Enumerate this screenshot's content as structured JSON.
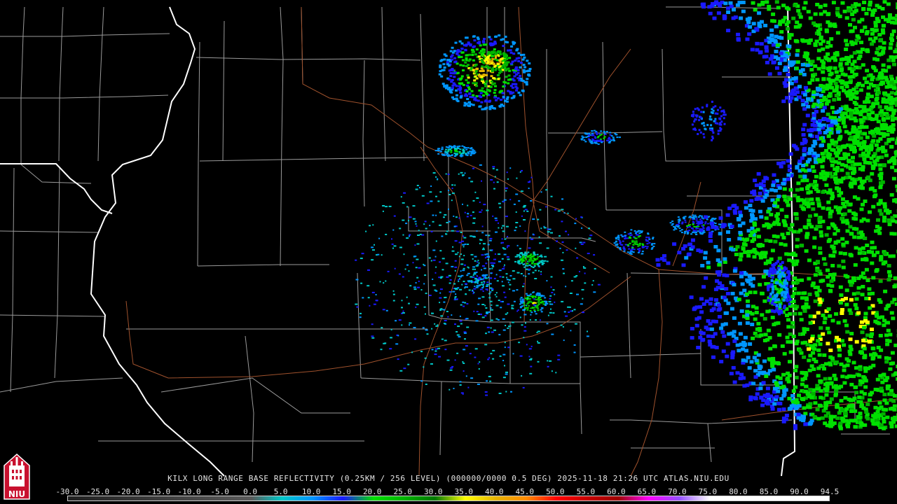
{
  "caption": "KILX LONG RANGE BASE REFLECTIVITY (0.25KM / 256 LEVEL) (000000/0000 0.5 DEG) 2025-11-18 21:26 UTC  ATLAS.NIU.EDU",
  "logo": {
    "text": "NIU",
    "colors": {
      "seal": "#c8102e",
      "tower": "#ffffff"
    }
  },
  "legend": {
    "labels": [
      "-30.0",
      "-25.0",
      "-20.0",
      "-15.0",
      "-10.0",
      "-5.0",
      "0.0",
      "5.0",
      "10.0",
      "15.0",
      "20.0",
      "25.0",
      "30.0",
      "35.0",
      "40.0",
      "45.0",
      "50.0",
      "55.0",
      "60.0",
      "65.0",
      "70.0",
      "75.0",
      "80.0",
      "85.0",
      "90.0",
      "94.5"
    ],
    "stops": [
      {
        "v": -30,
        "color": "#202020"
      },
      {
        "v": 0,
        "color": "#5a5a5a"
      },
      {
        "v": 5,
        "color": "#00c8c8"
      },
      {
        "v": 10,
        "color": "#0096ff"
      },
      {
        "v": 15,
        "color": "#1a1aff"
      },
      {
        "v": 20,
        "color": "#00e000"
      },
      {
        "v": 25,
        "color": "#00b400"
      },
      {
        "v": 30,
        "color": "#007800"
      },
      {
        "v": 35,
        "color": "#ffff00"
      },
      {
        "v": 40,
        "color": "#e6b400"
      },
      {
        "v": 45,
        "color": "#ff8c00"
      },
      {
        "v": 50,
        "color": "#ff0000"
      },
      {
        "v": 55,
        "color": "#c80000"
      },
      {
        "v": 60,
        "color": "#a00000"
      },
      {
        "v": 65,
        "color": "#ff00ff"
      },
      {
        "v": 70,
        "color": "#9650ff"
      },
      {
        "v": 75,
        "color": "#ffffff"
      },
      {
        "v": 94.5,
        "color": "#ffffff"
      }
    ]
  },
  "map_colors": {
    "background": "#000000",
    "county_lines": "#9a9a9a",
    "state_lines": "#ffffff",
    "highways": "#a0522d"
  }
}
